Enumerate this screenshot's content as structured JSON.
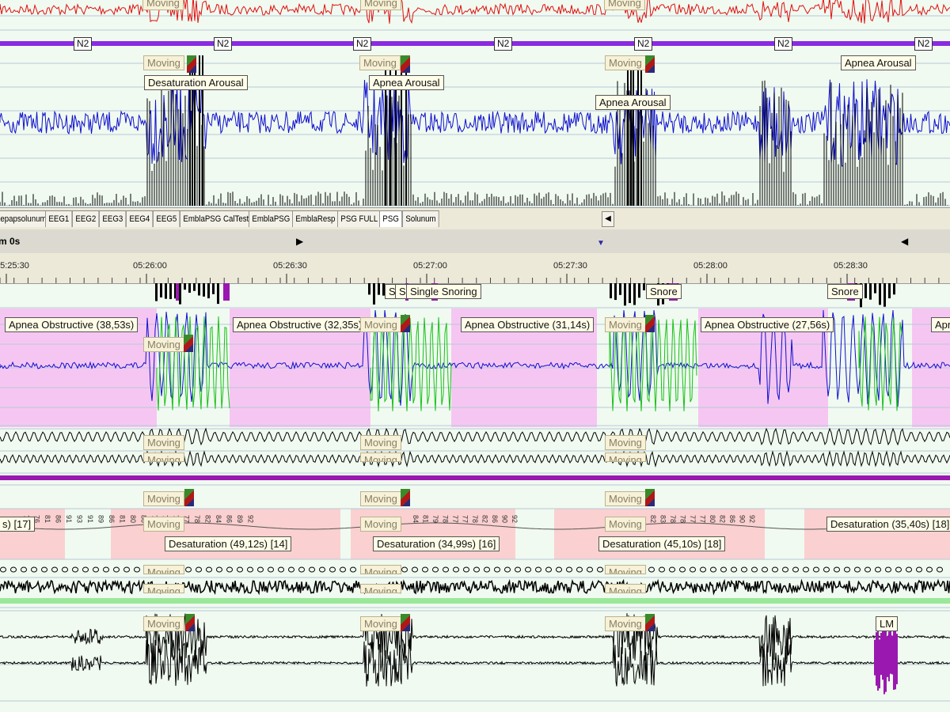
{
  "colors": {
    "eeg_red": "#e01010",
    "eeg_blue": "#1010d0",
    "hypno_purple": "#8a2be2",
    "pink_band": "#f6c6f2",
    "salmon_band": "#fbd0d0",
    "bg": "#f0faf0"
  },
  "top": {
    "moving_labels": [
      "Moving",
      "Moving",
      "Moving"
    ],
    "stages": [
      "N2",
      "N2",
      "N2",
      "N2",
      "N2",
      "N2",
      "N2"
    ],
    "moving2": [
      "Moving",
      "Moving",
      "Moving"
    ],
    "events": [
      "Desaturation Arousal",
      "Apnea Arousal",
      "Apnea Arousal",
      "Apnea Arousal"
    ]
  },
  "tabs": [
    "epapsolunum",
    "EEG1",
    "EEG2",
    "EEG3",
    "EEG4",
    "EEG5",
    "EmblaPSG CalTest",
    "EmblaPSG",
    "EmblaResp",
    "PSG FULL",
    "PSG",
    "Solunum"
  ],
  "nav": {
    "position": "m 0s"
  },
  "timeline": {
    "ticks": [
      "05:25:30",
      "05:26:00",
      "05:26:30",
      "05:27:00",
      "05:27:30",
      "05:28:00",
      "05:28:30"
    ]
  },
  "snore": {
    "s1": "S",
    "s2": "Si",
    "single": "Single Snoring",
    "snore1": "Snore",
    "snore2": "Snore"
  },
  "apnea": {
    "events": [
      "Apnea Obstructive (38,53s)",
      "Apnea Obstructive (32,35s)",
      "Apnea Obstructive (31,14s)",
      "Apnea Obstructive (27,56s)",
      "Apn"
    ],
    "moving": [
      "Moving",
      "Moving",
      "Moving"
    ]
  },
  "belts": {
    "moving": [
      "Moving",
      "Moving",
      "Moving",
      "Moving",
      "Moving",
      "Moving"
    ]
  },
  "spo2": {
    "moving_top": [
      "Moving",
      "Moving",
      "Moving"
    ],
    "moving": [
      "Moving",
      "Moving",
      "Moving"
    ],
    "desat_left": "s) [17]",
    "desat": [
      "Desaturation (49,12s) [14]",
      "Desaturation (34,99s) [16]",
      "Desaturation (45,10s) [18]",
      "Desaturation (35,40s) [18]"
    ],
    "values_a": [
      "76",
      "76",
      "81",
      "86",
      "91",
      "93",
      "91",
      "89",
      "86",
      "81",
      "80",
      "80",
      "79",
      "78",
      "78",
      "77",
      "78",
      "82",
      "84",
      "86",
      "89",
      "92"
    ],
    "values_b": [
      "84",
      "81",
      "79",
      "78",
      "77",
      "77",
      "78",
      "82",
      "86",
      "90",
      "92"
    ],
    "values_c": [
      "82",
      "83",
      "78",
      "78",
      "77",
      "77",
      "80",
      "82",
      "86",
      "90",
      "92"
    ]
  },
  "pulse": {
    "moving": [
      "Moving",
      "Moving",
      "Moving",
      "Moving",
      "Moving",
      "Moving"
    ]
  },
  "emg": {
    "moving": [
      "Moving",
      "Moving",
      "Moving"
    ],
    "lm": "LM"
  }
}
